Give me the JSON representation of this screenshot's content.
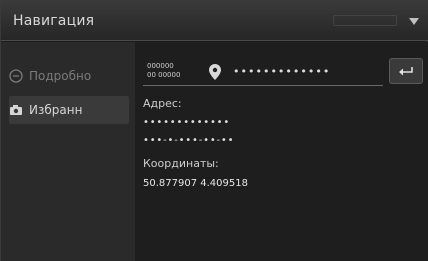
{
  "header": {
    "title": "Навигация"
  },
  "sidebar": {
    "items": [
      {
        "label": "Подробно",
        "icon": "info-icon",
        "active": false
      },
      {
        "label": "Избранн",
        "icon": "camera-icon",
        "active": true
      }
    ]
  },
  "search": {
    "zip_line1": "000000",
    "zip_line2": "00 00000",
    "query": "•••••••••••••",
    "pin_icon": "location-pin-icon"
  },
  "details": {
    "address_label": "Адрес:",
    "address_line1": "•••••••••••••",
    "address_line2": "•••-•-•••-••-••",
    "coords_label": "Координаты:",
    "coords_value": "50.877907 4.409518"
  },
  "colors": {
    "background": "#1c1c1c",
    "sidebar": "#2a2a2a",
    "text": "#dcdcdc"
  }
}
